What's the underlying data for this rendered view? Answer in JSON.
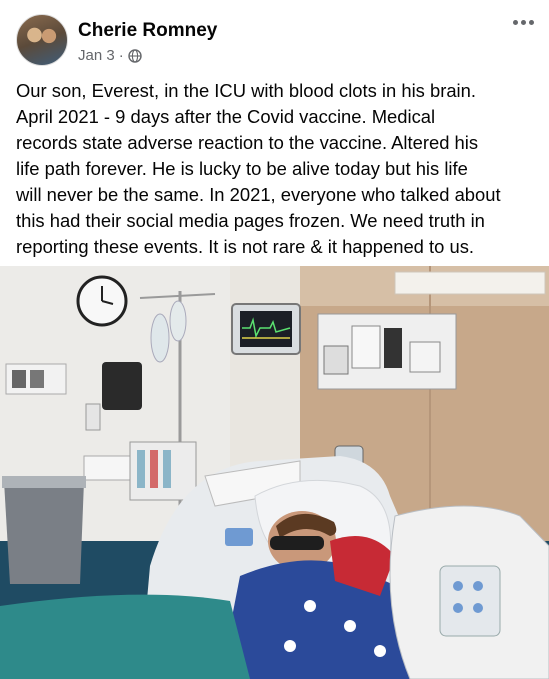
{
  "post": {
    "author": "Cherie Romney",
    "date": "Jan 3",
    "separator": "·",
    "visibility_icon": "globe-icon",
    "more_icon": "more-options-icon",
    "text": "Our son, Everest, in the ICU with blood clots in his brain.\nApril 2021 - 9 days after the Covid vaccine. Medical\nrecords state adverse reaction to the vaccine. Altered his\nlife path forever. He is lucky to be alive today but his life\nwill never be the same. In 2021, everyone who talked about\nthis had their social media pages frozen. We need truth in\nreporting these events. It is not rare & it happened to us."
  },
  "photo": {
    "subject": "hospital-icu-room-photo",
    "colors": {
      "wall": "#e9e6e0",
      "wood_panel": "#c7a88a",
      "floor": "#1f4b63",
      "sheet": "#2e8a8a",
      "bed_frame": "#f1f1f1"
    }
  }
}
